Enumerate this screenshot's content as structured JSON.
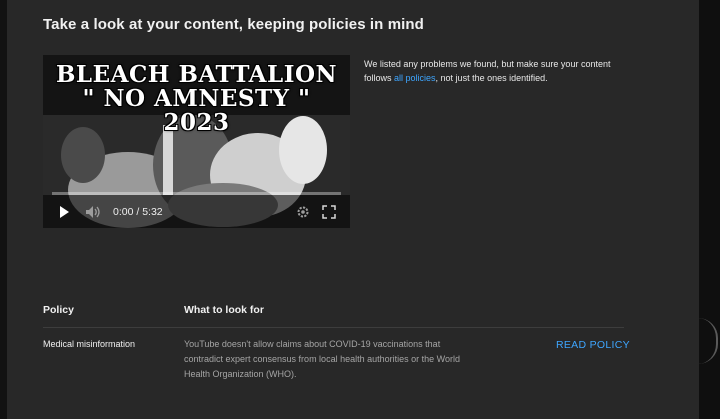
{
  "page": {
    "title": "Take a look at your content, keeping policies in mind"
  },
  "video": {
    "thumbnail_lines": [
      "BLEACH BATTALION",
      "\" NO AMNESTY \"",
      "2023"
    ],
    "time": "0:00 / 5:32",
    "progress": 0
  },
  "description": {
    "before": "We listed any problems we found, but make sure your content follows ",
    "link": "all policies",
    "after": ", not just the ones identified."
  },
  "table": {
    "headers": {
      "policy": "Policy",
      "look_for": "What to look for"
    },
    "rows": [
      {
        "policy": "Medical misinformation",
        "look_for": "YouTube doesn't allow claims about COVID-19 vaccinations that contradict expert consensus from local health authorities or the World Health Organization (WHO).",
        "action": "READ POLICY"
      }
    ]
  },
  "colors": {
    "panel": "#282828",
    "link": "#3ea6ff",
    "muted_text": "#a5a5a5"
  },
  "icons": [
    "play-icon",
    "volume-icon",
    "settings-gear-icon",
    "fullscreen-icon"
  ]
}
